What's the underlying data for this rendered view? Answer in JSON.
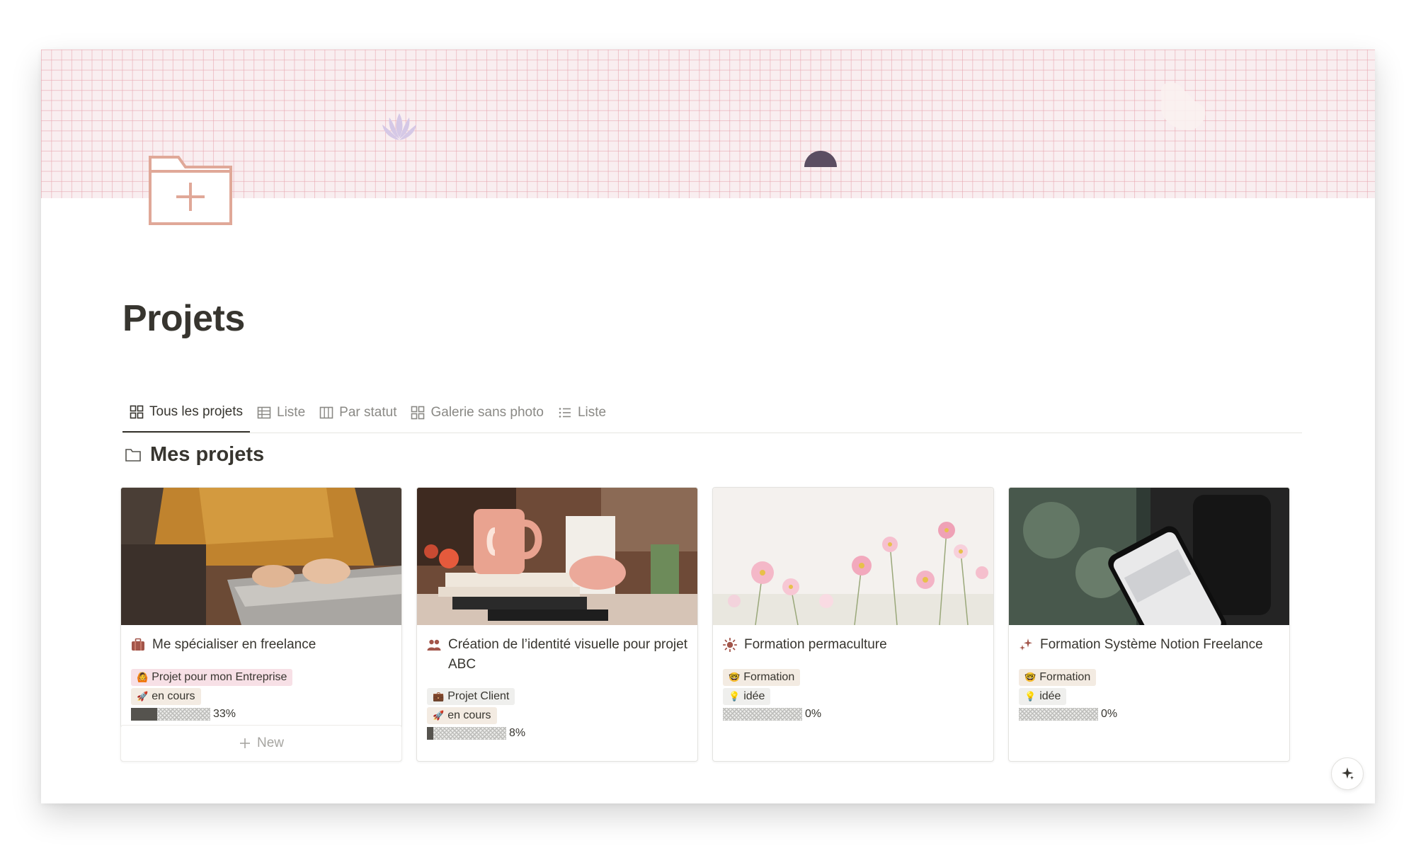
{
  "page": {
    "title": "Projets",
    "icon": "folder-plus-icon"
  },
  "tabs": [
    {
      "label": "Tous les projets",
      "icon": "gallery-icon",
      "active": true
    },
    {
      "label": "Liste",
      "icon": "table-icon",
      "active": false
    },
    {
      "label": "Par statut",
      "icon": "board-icon",
      "active": false
    },
    {
      "label": "Galerie sans photo",
      "icon": "gallery-icon",
      "active": false
    },
    {
      "label": "Liste",
      "icon": "list-icon",
      "active": false
    }
  ],
  "section": {
    "title": "Mes projets",
    "icon": "folder-outline-icon"
  },
  "cards": [
    {
      "title": "Me spécialiser en freelance",
      "icon": "briefcase-icon",
      "image": "laptop-photo",
      "category": {
        "label": "Projet pour mon Entreprise",
        "emoji": "🙆",
        "color": "#f7e0e6"
      },
      "status": {
        "label": "en cours",
        "emoji": "🚀"
      },
      "progress": {
        "label": "33%",
        "value": 0.33
      }
    },
    {
      "title": "Création de l’identité visuelle pour projet ABC",
      "icon": "people-icon",
      "image": "desk-mug-photo",
      "category": {
        "label": "Projet Client",
        "emoji": "💼",
        "color": "#efefed"
      },
      "status": {
        "label": "en cours",
        "emoji": "🚀"
      },
      "progress": {
        "label": "8%",
        "value": 0.08
      }
    },
    {
      "title": "Formation permaculture",
      "icon": "sun-icon",
      "image": "flowers-photo",
      "category": {
        "label": "Formation",
        "emoji": "🤓",
        "color": "#f3ebe2"
      },
      "status": {
        "label": "idée",
        "emoji": "💡"
      },
      "progress": {
        "label": "0%",
        "value": 0
      }
    },
    {
      "title": "Formation Système Notion Freelance",
      "icon": "sparkles-icon",
      "image": "phone-podcast-photo",
      "category": {
        "label": "Formation",
        "emoji": "🤓",
        "color": "#f3ebe2"
      },
      "status": {
        "label": "idée",
        "emoji": "💡"
      },
      "progress": {
        "label": "0%",
        "value": 0
      }
    }
  ],
  "new_button": {
    "label": "New"
  },
  "colors": {
    "accent_icon": "#e0a898",
    "grid_bg": "#f9eef0",
    "text": "#37352f"
  }
}
